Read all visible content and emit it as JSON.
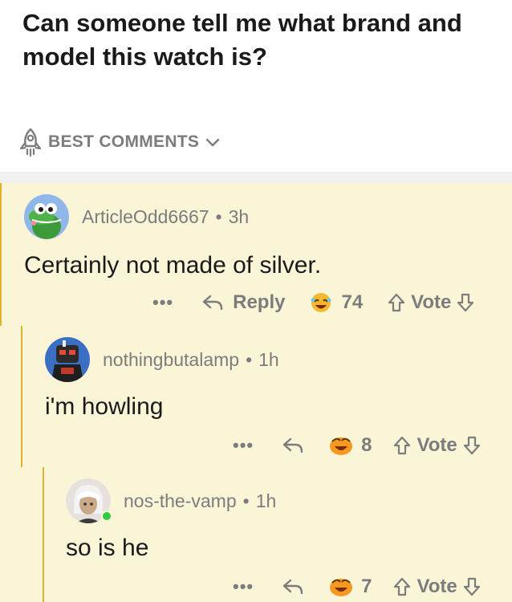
{
  "post": {
    "title": "Can someone tell me what brand and model this watch is?"
  },
  "sort": {
    "icon": "rocket-icon",
    "label": "BEST COMMENTS"
  },
  "colors": {
    "thread_background": "#fbf5d8",
    "thread_line": "#e3b22c",
    "meta_text": "#7c7c7c",
    "online_indicator": "#2ecc40"
  },
  "comments": [
    {
      "username": "ArticleOdd6667",
      "separator": "•",
      "time": "3h",
      "body": "Certainly not made of silver.",
      "more": "•••",
      "reply_label": "Reply",
      "award_count": "74",
      "vote_label": "Vote"
    },
    {
      "username": "nothingbutalamp",
      "separator": "•",
      "time": "1h",
      "body": "i'm howling",
      "more": "•••",
      "reply_label": "",
      "award_count": "8",
      "vote_label": "Vote"
    },
    {
      "username": "nos-the-vamp",
      "separator": "•",
      "time": "1h",
      "body": "so is he",
      "more": "•••",
      "reply_label": "",
      "award_count": "7",
      "vote_label": "Vote"
    }
  ]
}
